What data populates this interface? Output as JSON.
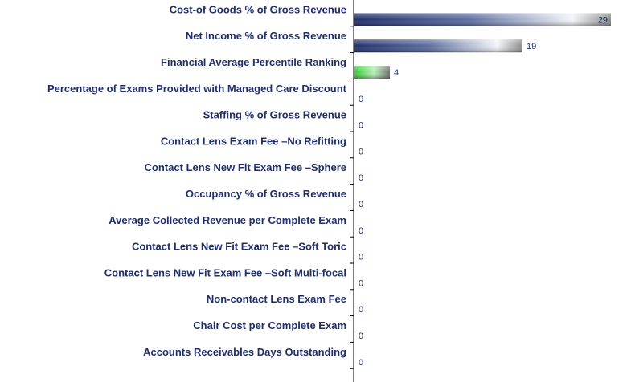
{
  "chart_data": {
    "type": "bar",
    "orientation": "horizontal",
    "categories": [
      "Cost-of Goods % of Gross Revenue",
      "Net Income % of Gross Revenue",
      "Financial Average Percentile Ranking",
      "Percentage of Exams Provided with Managed Care Discount",
      "Staffing % of Gross Revenue",
      "Contact Lens Exam Fee –No  Refitting",
      "Contact Lens New Fit Exam Fee –Sphere",
      "Occupancy % of Gross Revenue",
      "Average Collected Revenue per Complete Exam",
      "Contact Lens New Fit Exam Fee –Soft  Toric",
      "Contact Lens New Fit Exam Fee –Soft  Multi-focal",
      "Non-contact Lens Exam Fee",
      "Chair Cost per Complete Exam",
      "Accounts Receivables Days Outstanding"
    ],
    "values": [
      29,
      19,
      4,
      0,
      0,
      0,
      0,
      0,
      0,
      0,
      0,
      0,
      0,
      0
    ],
    "value_labels": [
      "29",
      "19",
      "4",
      "0",
      "0",
      "0",
      "0",
      "0",
      "0",
      "0",
      "0",
      "0",
      "0",
      "0"
    ],
    "highlight_index": 2,
    "xlim": [
      0,
      30
    ],
    "grid": false,
    "legend": "none",
    "title": "",
    "xlabel": "",
    "ylabel": "",
    "colors": {
      "bar_dark": "#1f2f6b",
      "bar_light": "#ffffff",
      "highlight_bar": "#2ecc2e",
      "highlight_end": "#777777",
      "axis": "#000000",
      "text": "#1f2f6b"
    }
  }
}
